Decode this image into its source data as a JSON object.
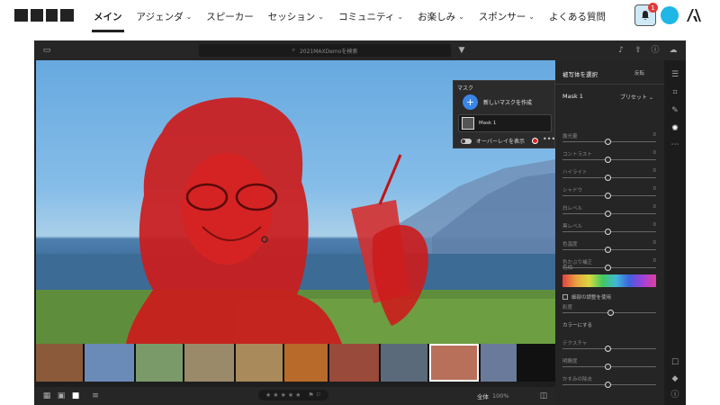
{
  "nav": {
    "items": [
      {
        "label": "メイン",
        "chevron": false
      },
      {
        "label": "アジェンダ",
        "chevron": true
      },
      {
        "label": "スピーカー",
        "chevron": false
      },
      {
        "label": "セッション",
        "chevron": true
      },
      {
        "label": "コミュニティ",
        "chevron": true
      },
      {
        "label": "お楽しみ",
        "chevron": true
      },
      {
        "label": "スポンサー",
        "chevron": true
      },
      {
        "label": "よくある質問",
        "chevron": false
      }
    ],
    "notification_count": "1"
  },
  "app": {
    "search_placeholder": "2021MAXDemoを検索",
    "mask_panel": {
      "title": "マスク",
      "create_label": "新しいマスクを作成",
      "mask_item": "Mask 1",
      "overlay_label": "オーバーレイを表示"
    },
    "right_panel": {
      "header": "被写体を選択",
      "invert_label": "反転",
      "mask_name": "Mask 1",
      "preset_label": "プリセット",
      "sliders": [
        {
          "label": "露光量",
          "value": "0",
          "level": 0.5
        },
        {
          "label": "コントラスト",
          "value": "0",
          "level": 0.5
        },
        {
          "label": "ハイライト",
          "value": "0",
          "level": 0.5
        },
        {
          "label": "シャドウ",
          "value": "0",
          "level": 0.5
        },
        {
          "label": "白レベル",
          "value": "0",
          "level": 0.5
        },
        {
          "label": "黒レベル",
          "value": "0",
          "level": 0.5
        },
        {
          "label": "色温度",
          "value": "0",
          "level": 0.5
        },
        {
          "label": "色かぶり補正",
          "value": "0",
          "level": 0.5
        },
        {
          "label": "色相",
          "value": "0",
          "level": 0.5
        }
      ],
      "fine_adjust_label": "細部の調整を使用",
      "saturation_label": "彩度",
      "colorize_label": "カラーにする",
      "texture_labels": [
        "テクスチャ",
        "明瞭度",
        "かすみの除去"
      ]
    },
    "bottom": {
      "zoom_fit": "全体",
      "zoom_pct": "100%"
    }
  }
}
